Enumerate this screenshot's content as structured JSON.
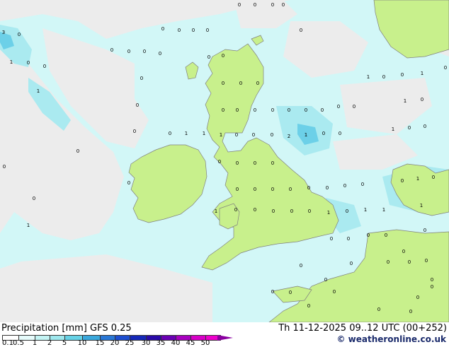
{
  "map": {
    "values": [
      {
        "t": "0"
      },
      {
        "t": "0"
      },
      {
        "t": "0"
      },
      {
        "t": "0"
      },
      {
        "t": "3"
      },
      {
        "t": "0"
      },
      {
        "t": "0"
      },
      {
        "t": "0"
      },
      {
        "t": "0"
      },
      {
        "t": "0"
      },
      {
        "t": "0"
      },
      {
        "t": "0"
      },
      {
        "t": "0"
      },
      {
        "t": "0"
      },
      {
        "t": "0"
      },
      {
        "t": "0"
      },
      {
        "t": "0"
      },
      {
        "t": "1"
      },
      {
        "t": "0"
      },
      {
        "t": "0"
      },
      {
        "t": "0"
      },
      {
        "t": "0"
      },
      {
        "t": "0"
      },
      {
        "t": "1"
      },
      {
        "t": "0"
      },
      {
        "t": "0"
      },
      {
        "t": "1"
      },
      {
        "t": "0"
      },
      {
        "t": "0"
      },
      {
        "t": "1"
      },
      {
        "t": "0"
      },
      {
        "t": "0"
      },
      {
        "t": "0"
      },
      {
        "t": "0"
      },
      {
        "t": "0"
      },
      {
        "t": "0"
      },
      {
        "t": "0"
      },
      {
        "t": "0"
      },
      {
        "t": "0"
      },
      {
        "t": "0"
      },
      {
        "t": "1"
      },
      {
        "t": "0"
      },
      {
        "t": "0"
      },
      {
        "t": "0"
      },
      {
        "t": "1"
      },
      {
        "t": "1"
      },
      {
        "t": "1"
      },
      {
        "t": "0"
      },
      {
        "t": "0"
      },
      {
        "t": "0"
      },
      {
        "t": "2"
      },
      {
        "t": "1"
      },
      {
        "t": "0"
      },
      {
        "t": "0"
      },
      {
        "t": "1"
      },
      {
        "t": "0"
      },
      {
        "t": "0"
      },
      {
        "t": "0"
      },
      {
        "t": "0"
      },
      {
        "t": "0"
      },
      {
        "t": "0"
      },
      {
        "t": "0"
      },
      {
        "t": "0"
      },
      {
        "t": "0"
      },
      {
        "t": "0"
      },
      {
        "t": "0"
      },
      {
        "t": "0"
      },
      {
        "t": "0"
      },
      {
        "t": "0"
      },
      {
        "t": "0"
      },
      {
        "t": "0"
      },
      {
        "t": "0"
      },
      {
        "t": "0"
      },
      {
        "t": "0"
      },
      {
        "t": "1"
      },
      {
        "t": "0"
      },
      {
        "t": "1"
      },
      {
        "t": "0"
      },
      {
        "t": "0"
      },
      {
        "t": "0"
      },
      {
        "t": "0"
      },
      {
        "t": "0"
      },
      {
        "t": "1"
      },
      {
        "t": "0"
      },
      {
        "t": "1"
      },
      {
        "t": "1"
      },
      {
        "t": "1"
      },
      {
        "t": "1"
      },
      {
        "t": "0"
      },
      {
        "t": "0"
      },
      {
        "t": "0"
      },
      {
        "t": "0"
      },
      {
        "t": "0"
      },
      {
        "t": "0"
      },
      {
        "t": "0"
      },
      {
        "t": "0"
      },
      {
        "t": "0"
      },
      {
        "t": "0"
      },
      {
        "t": "0"
      },
      {
        "t": "0"
      },
      {
        "t": "0"
      },
      {
        "t": "0"
      },
      {
        "t": "0"
      },
      {
        "t": "0"
      },
      {
        "t": "0"
      },
      {
        "t": "0"
      },
      {
        "t": "0"
      },
      {
        "t": "0"
      },
      {
        "t": "0"
      },
      {
        "t": "0"
      }
    ]
  },
  "legend": {
    "title": "Precipitation [mm]  GFS 0.25",
    "datetime": "Th 11-12-2025 09..12 UTC (00+252)",
    "copyright": "© weatheronline.co.uk",
    "scale": [
      {
        "label": "0.1",
        "color": "#ffffff"
      },
      {
        "label": "0.5",
        "color": "#e6fbfb"
      },
      {
        "label": "1",
        "color": "#c4f4f4"
      },
      {
        "label": "2",
        "color": "#9ee8ee"
      },
      {
        "label": "5",
        "color": "#66d2e6"
      },
      {
        "label": "10",
        "color": "#3aa8dc"
      },
      {
        "label": "15",
        "color": "#2a78d6"
      },
      {
        "label": "20",
        "color": "#1e4ed0"
      },
      {
        "label": "25",
        "color": "#1528b8"
      },
      {
        "label": "30",
        "color": "#2a0aa8"
      },
      {
        "label": "35",
        "color": "#6a00b4"
      },
      {
        "label": "40",
        "color": "#a800c0"
      },
      {
        "label": "45",
        "color": "#d800c8"
      },
      {
        "label": "50",
        "color": "#ee00cc"
      }
    ]
  },
  "colors": {
    "ocean": "#ececec",
    "land": "#c8f08c",
    "rain_light": "#d2f7f7",
    "rain_moderate": "#aaeaf0",
    "rain_heavy": "#6cd0e8",
    "coastline": "#808080"
  }
}
